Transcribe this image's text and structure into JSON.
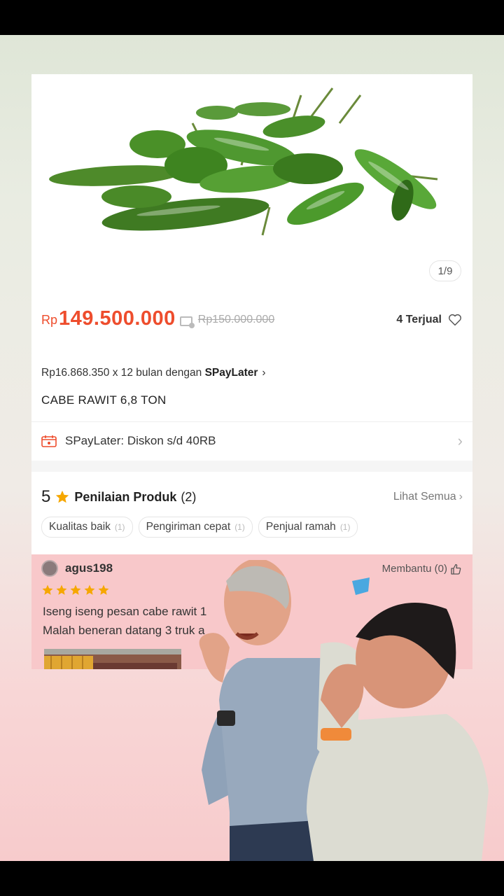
{
  "product": {
    "image_counter": "1/9",
    "price_currency": "Rp",
    "price": "149.500.000",
    "original_price": "Rp150.000.000",
    "sold": "4 Terjual",
    "installment_prefix": "Rp16.868.350 x 12 bulan dengan ",
    "installment_brand": "SPayLater",
    "installment_chevron": "›",
    "title": "CABE RAWIT 6,8 TON"
  },
  "promo": {
    "label": "SPayLater: Diskon s/d 40RB",
    "chevron": "›"
  },
  "ratings": {
    "score": "5",
    "title": "Penilaian Produk",
    "count": "(2)",
    "see_all": "Lihat Semua",
    "see_all_chevron": "›",
    "tags": [
      {
        "label": "Kualitas baik",
        "count": "(1)"
      },
      {
        "label": "Pengiriman cepat",
        "count": "(1)"
      },
      {
        "label": "Penjual ramah",
        "count": "(1)"
      }
    ]
  },
  "review": {
    "username": "agus198",
    "helpful": "Membantu (0)",
    "stars": 5,
    "line1": "Iseng iseng pesan cabe rawit 1",
    "line2": "Malah beneran datang 3 truk a"
  },
  "colors": {
    "accent": "#ee4d2d",
    "star": "#f6a700",
    "review_bg": "#f8c8ca"
  },
  "icons": [
    "heart-icon",
    "spaylater-icon",
    "star-icon",
    "thumb-up-icon"
  ]
}
